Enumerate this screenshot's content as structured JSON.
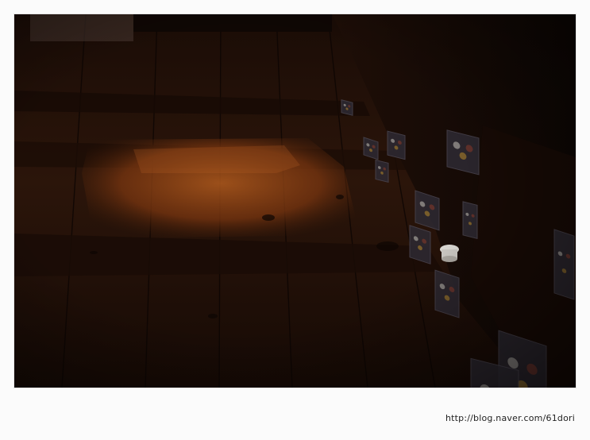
{
  "photo": {
    "scene": "dark wooden floor with painted wall panels",
    "colors": {
      "floor": "#2a160c",
      "floor_dark": "#120905",
      "light_patch": "#7a3810",
      "light_patch_hot": "#b25a1c",
      "panel_wall": "#1e0e08",
      "panel_art": "#2e2a33"
    }
  },
  "caption": {
    "url_text": "http://blog.naver.com/61dori"
  }
}
